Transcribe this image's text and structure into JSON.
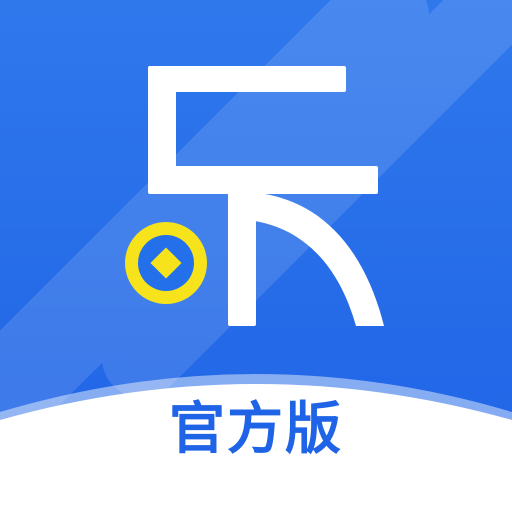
{
  "app_icon": {
    "edition_label": "官方版",
    "logo_character": "乐",
    "coin_icon": "coin-icon",
    "colors": {
      "background": "#2370ea",
      "background_light": "#3a86f2",
      "glyph": "#ffffff",
      "coin_ring": "#f7e31c",
      "coin_inner": "#2370ea",
      "label_band": "#ffffff",
      "label_text": "#1f63e6"
    }
  }
}
